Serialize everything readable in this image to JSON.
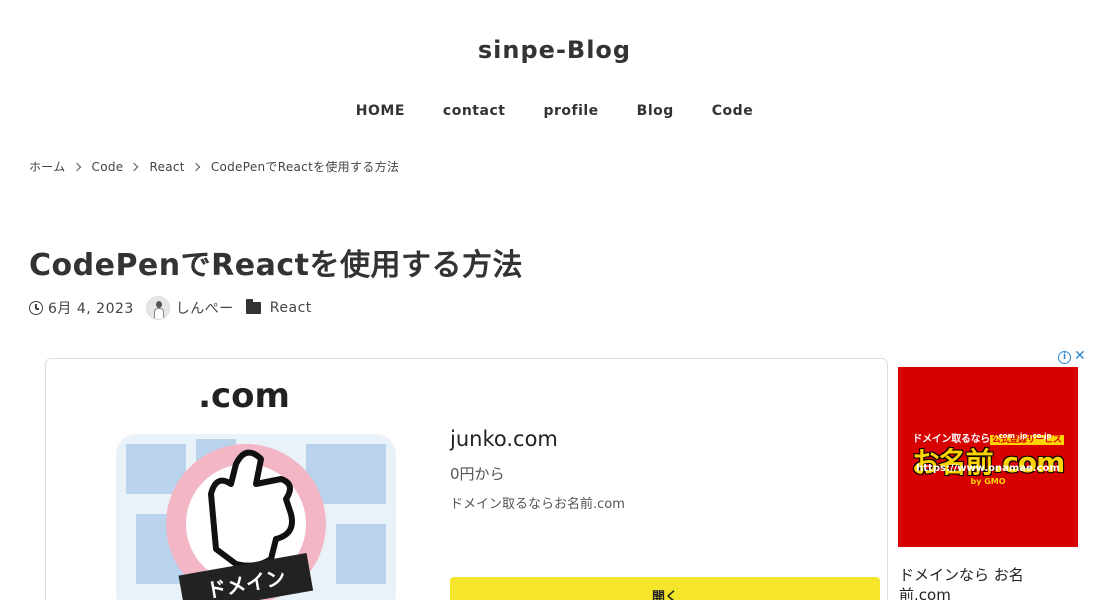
{
  "site": {
    "title": "sinpe-Blog"
  },
  "nav": [
    {
      "label": "HOME"
    },
    {
      "label": "contact"
    },
    {
      "label": "profile"
    },
    {
      "label": "Blog"
    },
    {
      "label": "Code"
    }
  ],
  "breadcrumb": [
    {
      "label": "ホーム"
    },
    {
      "label": "Code"
    },
    {
      "label": "React"
    },
    {
      "label": "CodePenでReactを使用する方法"
    }
  ],
  "post": {
    "title": "CodePenでReactを使用する方法",
    "date": "6月 4, 2023",
    "author": "しんぺー",
    "category": "React"
  },
  "card": {
    "image_label": ".com",
    "image_tag": "ドメイン",
    "title": "junko.com",
    "price": "0円から",
    "description": "ドメイン取るならお名前.com",
    "button": "開く"
  },
  "ad": {
    "info_icon": "info-icon",
    "close_icon": "close-icon",
    "banner_line1": "ドメイン取るなら",
    "banner_badge": "公式登録サービス",
    "banner_main": "お名前.com",
    "banner_tld": ".com  .jp  .co.jp",
    "banner_url": "https://www.onamae.com",
    "banner_gmo": "by GMO",
    "caption": "ドメインなら お名前.com",
    "colors": {
      "banner_bg": "#d60000",
      "banner_accent": "#ffd400"
    }
  },
  "colors": {
    "button_bg": "#f5e52b",
    "text": "#333333"
  }
}
